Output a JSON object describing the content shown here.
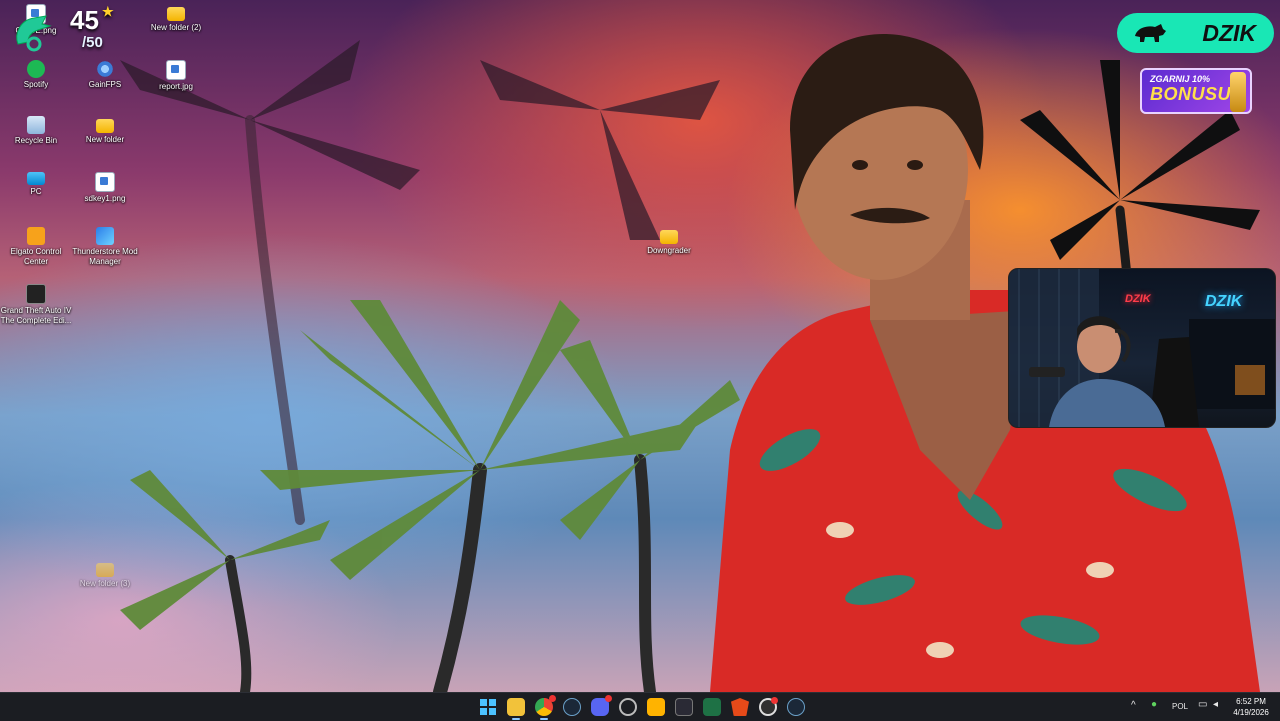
{
  "desktop": {
    "icons": [
      {
        "label": "GUIDE.png",
        "icon": "image-file-icon"
      },
      {
        "label": "New folder (2)",
        "icon": "folder-icon"
      },
      {
        "label": "Spotify",
        "icon": "spotify-icon"
      },
      {
        "label": "GainFPS",
        "icon": "gear-icon"
      },
      {
        "label": "report.jpg",
        "icon": "image-file-icon"
      },
      {
        "label": "Recycle Bin",
        "icon": "recycle-bin-icon"
      },
      {
        "label": "New folder",
        "icon": "folder-icon"
      },
      {
        "label": "PC",
        "icon": "computer-icon"
      },
      {
        "label": "sdkey1.png",
        "icon": "image-file-icon"
      },
      {
        "label": "Elgato Control Center",
        "icon": "elgato-icon"
      },
      {
        "label": "Thunderstore Mod Manager",
        "icon": "thunderstore-icon"
      },
      {
        "label": "Downgrader",
        "icon": "folder-icon"
      },
      {
        "label": "Grand Theft Auto IV The Complete Edi...",
        "icon": "gta-icon"
      },
      {
        "label": "New folder (3)",
        "icon": "folder-icon"
      }
    ]
  },
  "overlay": {
    "score_current": "45",
    "score_total": "/50",
    "brand": "DZIK",
    "bonus_line1": "ZGARNIJ 10%",
    "bonus_line2": "BONUSU",
    "webcam_sign_left": "DZIK",
    "webcam_sign_right": "DZIK"
  },
  "taskbar": {
    "apps": [
      {
        "icon": "windows-start-icon"
      },
      {
        "icon": "file-explorer-icon",
        "active": true
      },
      {
        "icon": "chrome-icon",
        "active": true
      },
      {
        "icon": "steam-icon"
      },
      {
        "icon": "discord-icon"
      },
      {
        "icon": "media-app-icon"
      },
      {
        "icon": "sun-app-icon"
      },
      {
        "icon": "elgato-stream-deck-icon"
      },
      {
        "icon": "excel-icon"
      },
      {
        "icon": "brave-icon"
      },
      {
        "icon": "obs-icon"
      },
      {
        "icon": "steam-icon"
      }
    ],
    "tray": {
      "language": "POL",
      "time": "6:52 PM",
      "date": "4/19/2026"
    }
  },
  "colors": {
    "brand_accent": "#19e7b5",
    "bonus_purple": "#7a3ae0",
    "taskbar_bg": "#1b1d22"
  }
}
